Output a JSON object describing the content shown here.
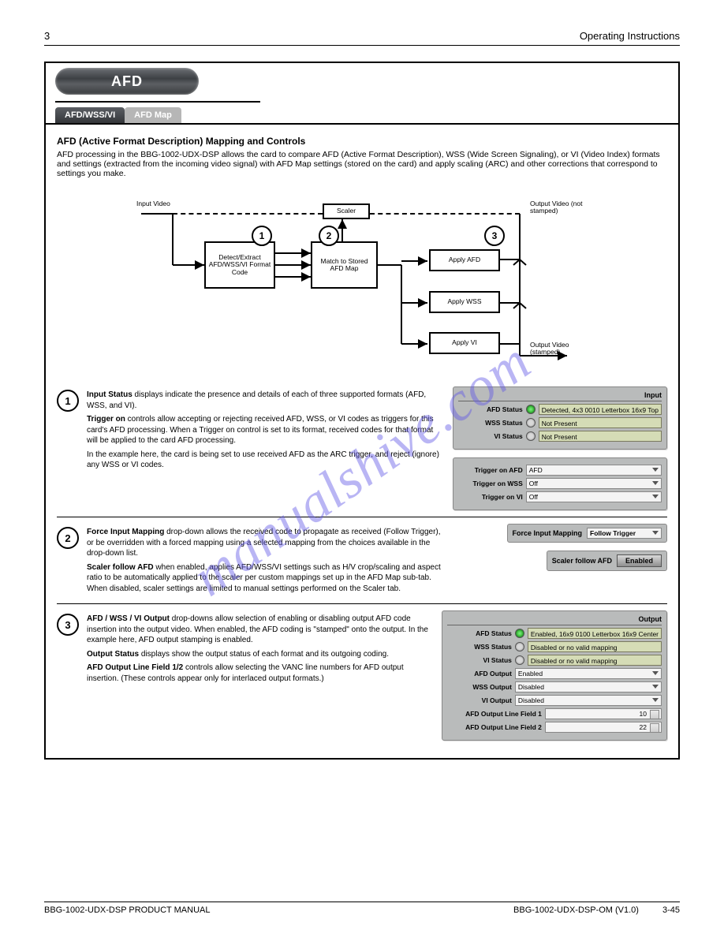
{
  "header": {
    "chapter": "3",
    "title": "Operating Instructions"
  },
  "title_section": {
    "pill": "AFD",
    "tabs": [
      "AFD/WSS/VI",
      "AFD Map"
    ]
  },
  "intro": {
    "heading": "AFD (Active Format Description) Mapping and Controls",
    "p1": "AFD processing in the BBG-1002-UDX-DSP allows the card to compare AFD (Active Format Description), WSS (Wide Screen Signaling), or VI (Video Index) formats and settings (extracted from the incoming video signal) with AFD Map settings (stored on the card) and apply scaling (ARC) and other corrections that correspond to settings you make.",
    "diagram": {
      "input_label": "Input Video",
      "scaler_label": "Scaler",
      "box_detect": "Detect/Extract AFD/WSS/VI Format Code",
      "box_map": "Match to Stored AFD Map",
      "box_afd": "Apply AFD",
      "box_wss": "Apply WSS",
      "box_vi": "Apply VI",
      "out_label": "Output Video (stamped)",
      "out_label2": "Output Video (not stamped)",
      "circles": {
        "a": "1",
        "b": "2",
        "c": "3"
      }
    }
  },
  "sec1": {
    "num": "1",
    "t1_bold": "Input Status",
    "t1": " displays indicate the presence and details of each of three supported formats (AFD, WSS, and VI).",
    "t2_bold": "Trigger on",
    "t2": " controls allow accepting or rejecting received AFD, WSS, or VI codes as triggers for this card's AFD processing. When a Trigger on control is set to its format, received codes for that format will be applied to the card AFD processing.",
    "t3": "In the example here, the card is being set to use received AFD as the ARC trigger, and reject (ignore) any WSS or VI codes.",
    "input_panel": {
      "title": "Input",
      "rows": [
        {
          "label": "AFD Status",
          "led": "green",
          "value": "Detected, 4x3 0010 Letterbox 16x9 Top"
        },
        {
          "label": "WSS Status",
          "led": "off",
          "value": "Not Present"
        },
        {
          "label": "VI Status",
          "led": "off",
          "value": "Not Present"
        }
      ]
    },
    "trigger_panel": {
      "rows": [
        {
          "label": "Trigger on AFD",
          "value": "AFD"
        },
        {
          "label": "Trigger on WSS",
          "value": "Off"
        },
        {
          "label": "Trigger on VI",
          "value": "Off"
        }
      ]
    }
  },
  "sec2": {
    "num": "2",
    "t1_bold": "Force Input Mapping",
    "t1": " drop-down allows the received code to propagate as received (Follow Trigger), or be overridden with a forced mapping using a selected mapping from the choices available in the drop-down list.",
    "t2_bold": "Scaler follow AFD",
    "t2": " when enabled, applies AFD/WSS/VI settings such as H/V crop/scaling and aspect ratio to be automatically applied to the scaler per custom mappings set up in the AFD Map sub-tab. When disabled, scaler settings are limited to manual settings performed on the Scaler tab.",
    "force_panel": {
      "label": "Force Input Mapping",
      "value": "Follow Trigger"
    },
    "scaler_panel": {
      "label": "Scaler follow AFD",
      "value": "Enabled"
    }
  },
  "sec3": {
    "num": "3",
    "t1_bold": "AFD / WSS / VI Output",
    "t1": " drop-downs allow selection of enabling or disabling output AFD code insertion into the output video. When enabled, the AFD coding is \"stamped\" onto the output. In the example here, AFD output stamping is enabled.",
    "t2_bold": "Output Status",
    "t2": " displays show the output status of each format and its outgoing coding.",
    "t3_bold": "AFD Output Line Field 1/2",
    "t3": " controls allow selecting the VANC line numbers for AFD output insertion. (These controls appear only for interlaced output formats.)",
    "output_panel": {
      "title": "Output",
      "status_rows": [
        {
          "label": "AFD Status",
          "led": "green",
          "value": "Enabled, 16x9 0100 Letterbox 16x9 Center"
        },
        {
          "label": "WSS Status",
          "led": "off",
          "value": "Disabled or no valid mapping"
        },
        {
          "label": "VI Status",
          "led": "off",
          "value": "Disabled or no valid mapping"
        }
      ],
      "dropdown_rows": [
        {
          "label": "AFD Output",
          "value": "Enabled"
        },
        {
          "label": "WSS Output",
          "value": "Disabled"
        },
        {
          "label": "VI Output",
          "value": "Disabled"
        }
      ],
      "num_rows": [
        {
          "label": "AFD Output Line Field 1",
          "value": "10"
        },
        {
          "label": "AFD Output Line Field 2",
          "value": "22"
        }
      ]
    }
  },
  "watermark": "manualshive.com",
  "footer": {
    "left": "BBG-1002-UDX-DSP PRODUCT MANUAL",
    "rev": "BBG-1002-UDX-DSP-OM (V1.0)",
    "page": "3-45"
  }
}
